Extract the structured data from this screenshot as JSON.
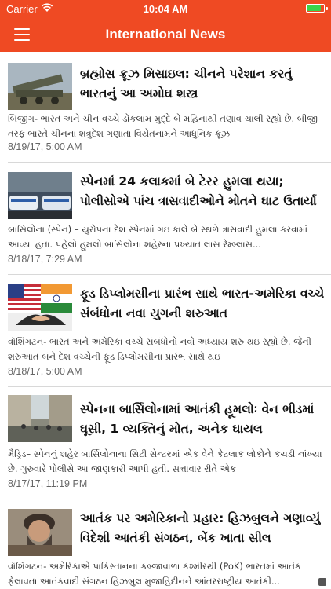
{
  "status_bar": {
    "carrier": "Carrier",
    "time": "10:04 AM",
    "battery_level": 0.85,
    "battery_color": "#3bd34a"
  },
  "nav": {
    "title": "International News",
    "menu_icon": "hamburger-menu-icon",
    "bar_color": "#ef4a23"
  },
  "articles": [
    {
      "headline": "બ્રહ્મોસ ક્રૂઝ મિસાઇલ: ચીનને પરેશાન કરતું ભારતનું આ અમોઘ શસ્ત્ર",
      "summary": "બિજીંગ- ભારત અને ચીન વચ્ચે ડોકલામ મુદ્દે બે મહિનાથી તણાવ ચાલી રહ્યો છે. બીજી તરફ ભારતે ચીનના શત્રુદેશ ગણાતા વિયેતનામને આધુનિક ક્રૂઝ",
      "timestamp": "8/19/17, 5:00 AM",
      "thumb": "missile-launch-image"
    },
    {
      "headline": "સ્પેનમાં 24 કલાકમાં બે ટેરર હુમલા થયા; પોલીસોએ પાંચ ત્રાસવાદીઓને મોતને ઘાટ ઉતાર્યા",
      "summary": "બાર્સિલોના (સ્પેન) – યુરોપના દેશ સ્પેનમાં ગઇ કાલે બે સ્થળે ત્રાસવાદી હુમલા કરવામાં આવ્યા હતા. પહેલો હુમલો બાર્સિલોના શહેરના પ્રખ્યાત લાસ રેમ્બ્લાસ...",
      "timestamp": "8/18/17, 7:29 AM",
      "thumb": "police-cars-image"
    },
    {
      "headline": "ફૂડ ડિપ્લોમસીના પ્રારંભ સાથે ભારત-અમેરિકા વચ્ચે સંબંધોના નવા યુગની શરુઆત",
      "summary": "વૉશિંગટન- ભારત અને અમેરિકા વચ્ચે સંબંધોનો નવો અધ્યાય શરુ થઇ રહ્યો છે. જેની શરુઆત બંને દેશ વચ્ચેની ફૂડ ડિપ્લોમસીના પ્રારંભ સાથે થઇ",
      "timestamp": "8/18/17, 5:00 AM",
      "thumb": "us-india-flags-handshake-image"
    },
    {
      "headline": "સ્પેનના બાર્સિલોનામાં આતંકી હૂમલોઃ વેન ભીડમાં ઘૂસી, 1 વ્યક્તિનું મોત, અનેક ઘાયલ",
      "summary": "મૈડ્રિડ– સ્પેનનું શહેર બાર્સિલોનાના સિટી સેન્ટરમાં એક વેને કેટલાક લોકોને કચડી નાંખ્યા છે. ગુરુવારે પોલીસે આ જાણકારી આપી હતી. સત્તાવાર રીતે એક",
      "timestamp": "8/17/17, 11:19 PM",
      "thumb": "barcelona-street-image"
    },
    {
      "headline": "આતંક પર અમેરિકાનો પ્રહાર: હિઝબુલને ગણાવ્યું વિદેશી આતંકી સંગઠન, બેંક ખાતા સીલ",
      "summary": "વૉશિંગટન- અમેરિકાએ પાકિસ્તાનના કબ્જાવાળા કશ્મીરથી (PoK) ભારતમાં આતંક ફેલાવતા આતંકવાદી સંગઠન હિઝબુલ મુજાહિદીનને આંતરરાષ્ટ્રીય આતંકી...",
      "timestamp": "",
      "thumb": "bearded-man-portrait-image"
    }
  ]
}
